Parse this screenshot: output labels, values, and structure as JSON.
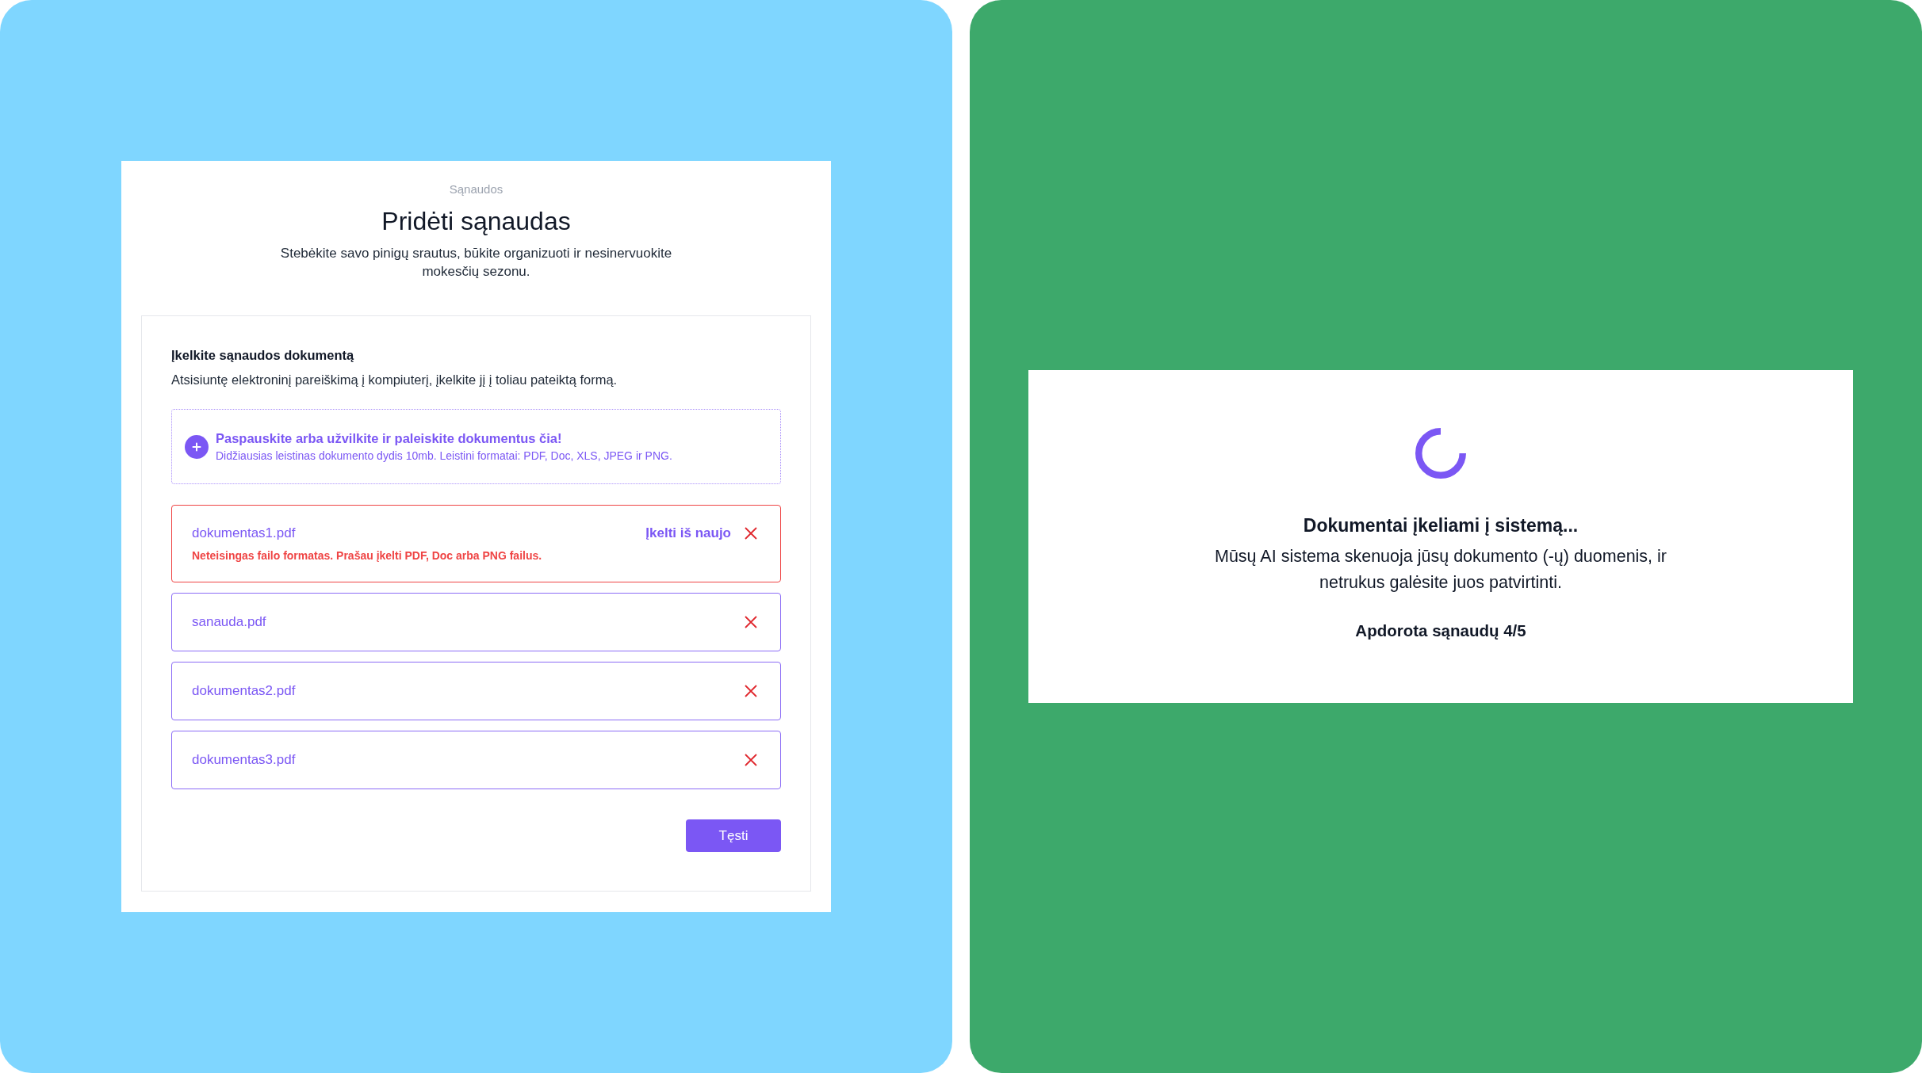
{
  "upload_panel": {
    "breadcrumb": "Sąnaudos",
    "title": "Pridėti sąnaudas",
    "subtitle": "Stebėkite savo pinigų srautus, būkite organizuoti ir nesinervuokite mokesčių sezonu.",
    "section": {
      "heading": "Įkelkite sąnaudos dokumentą",
      "description": "Atsisiuntę elektroninį pareiškimą į kompiuterį, įkelkite jį į toliau pateiktą formą.",
      "dropzone": {
        "prompt": "Paspauskite arba užvilkite ir paleiskite dokumentus čia!",
        "hint": "Didžiausias leistinas dokumento dydis 10mb. Leistini formatai: PDF, Doc, XLS, JPEG ir PNG."
      },
      "files": [
        {
          "name": "dokumentas1.pdf",
          "invalid": true,
          "retry_label": "Įkelti iš naujo",
          "error_message": "Neteisingas failo formatas. Prašau įkelti PDF, Doc arba PNG failus."
        },
        {
          "name": "sanauda.pdf",
          "invalid": false
        },
        {
          "name": "dokumentas2.pdf",
          "invalid": false
        },
        {
          "name": "dokumentas3.pdf",
          "invalid": false
        }
      ],
      "continue_button": "Tęsti"
    }
  },
  "processing_panel": {
    "title": "Dokumentai įkeliami į sistemą...",
    "message": "Mūsų AI sistema skenuoja jūsų dokumento (-ų) duomenis, ir netrukus galėsite juos patvirtinti.",
    "progress": "Apdorota sąnaudų 4/5"
  }
}
